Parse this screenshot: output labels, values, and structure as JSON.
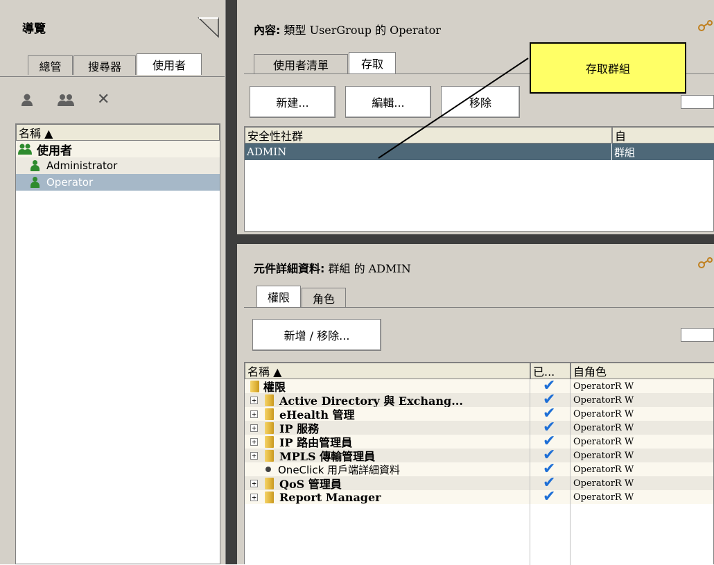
{
  "nav": {
    "title": "導覽",
    "tabs": [
      "總管",
      "搜尋器",
      "使用者"
    ],
    "tree_header": "名稱 ▲",
    "tree": {
      "root": "使用者",
      "items": [
        "Administrator",
        "Operator"
      ]
    }
  },
  "content": {
    "title_bold": "內容:",
    "title_rest": " 類型 UserGroup 的 Operator",
    "tabs": [
      "使用者清單",
      "存取"
    ],
    "buttons": {
      "new": "新建...",
      "edit": "編輯...",
      "remove": "移除"
    },
    "callout": "存取群組",
    "table": {
      "headers": [
        "安全性社群",
        "自"
      ],
      "rows": [
        {
          "name": "ADMIN",
          "from": "群組"
        }
      ]
    }
  },
  "details": {
    "title_bold": "元件詳細資料:",
    "title_rest": " 群組 的 ADMIN",
    "tabs": [
      "權限",
      "角色"
    ],
    "button": "新增 / 移除...",
    "table": {
      "headers": [
        "名稱 ▲",
        "已...",
        "自角色"
      ],
      "rows": [
        {
          "name": "權限",
          "role": "OperatorR W"
        },
        {
          "name": "Active Directory 與 Exchang...",
          "role": "OperatorR W"
        },
        {
          "name": "eHealth 管理",
          "role": "OperatorR W"
        },
        {
          "name": "IP 服務",
          "role": "OperatorR W"
        },
        {
          "name": "IP 路由管理員",
          "role": "OperatorR W"
        },
        {
          "name": "MPLS 傳輸管理員",
          "role": "OperatorR W"
        },
        {
          "name": "OneClick 用戶端詳細資料",
          "role": "OperatorR W"
        },
        {
          "name": "QoS 管理員",
          "role": "OperatorR W"
        },
        {
          "name": "Report Manager",
          "role": "OperatorR W"
        }
      ]
    }
  },
  "colors": {
    "selection": "#4e6878",
    "selection_light": "#a6b8c8",
    "callout": "#ffff66",
    "check": "#1e6fd6"
  }
}
